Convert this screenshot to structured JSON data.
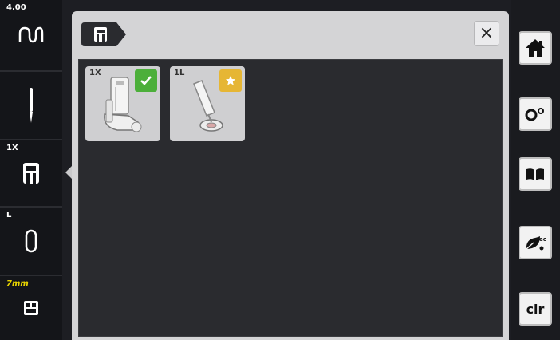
{
  "left_sidebar": {
    "stitch_width_value": "4.00",
    "presser_foot_code": "1X",
    "bobbin_code": "L",
    "stitch_length_value": "7mm"
  },
  "popup": {
    "close_glyph": "×",
    "feet": [
      {
        "code": "1X",
        "badge": "check-icon",
        "badge_color": "#4caf3a"
      },
      {
        "code": "1L",
        "badge": "star-icon",
        "badge_color": "#e6b634"
      }
    ]
  },
  "right_sidebar": {
    "buttons": [
      {
        "icon": "home-icon"
      },
      {
        "icon": "settings-icon"
      },
      {
        "icon": "tutorial-icon"
      },
      {
        "icon": "eco-icon"
      },
      {
        "label": "clr"
      }
    ]
  }
}
